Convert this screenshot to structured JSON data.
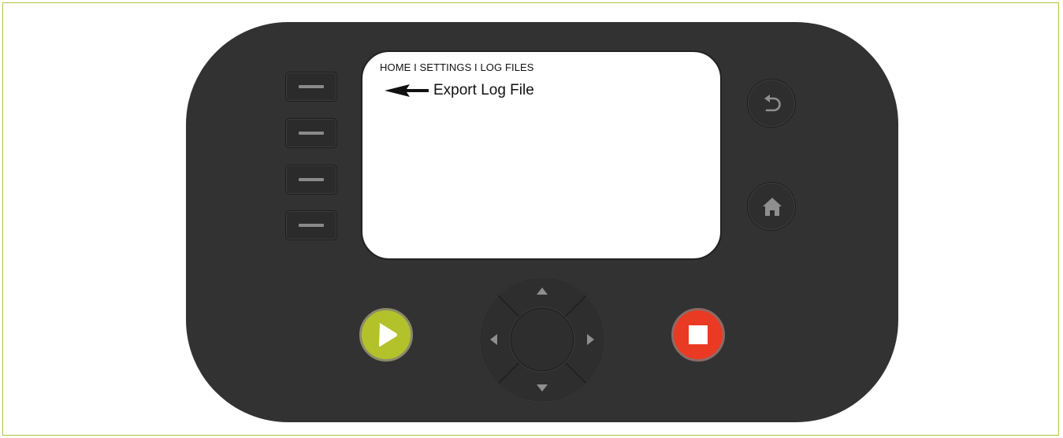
{
  "screen": {
    "breadcrumb": "HOME I SETTINGS I LOG FILES",
    "menu_item": {
      "label": "Export Log File",
      "icon": "arrow-left-icon"
    }
  },
  "softkeys": [
    {
      "icon": "dash-icon"
    },
    {
      "icon": "dash-icon"
    },
    {
      "icon": "dash-icon"
    },
    {
      "icon": "dash-icon"
    }
  ],
  "buttons": {
    "back": {
      "icon": "back-arrow-icon"
    },
    "home": {
      "icon": "home-icon"
    },
    "play": {
      "icon": "play-icon",
      "color": "#b3c22b"
    },
    "stop": {
      "icon": "stop-icon",
      "color": "#ea3a24"
    }
  },
  "dpad": {
    "up": "chevron-up-icon",
    "down": "chevron-down-icon",
    "left": "chevron-left-icon",
    "right": "chevron-right-icon",
    "center": "ok-button"
  },
  "colors": {
    "device_body": "#323232",
    "frame_border": "#b4c33a",
    "screen_bg": "#ffffff"
  }
}
